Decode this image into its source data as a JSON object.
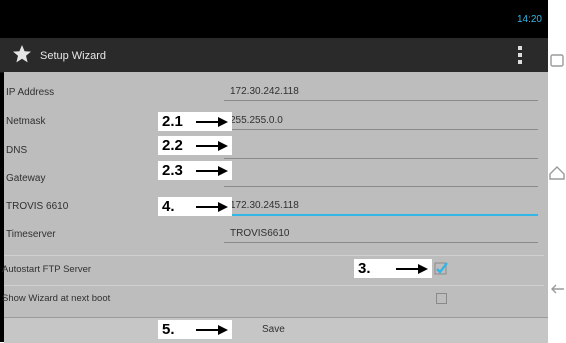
{
  "status_bar": {
    "time": "14:20"
  },
  "action_bar": {
    "title": "Setup Wizard",
    "app_icon": "star-icon",
    "menu_icon": "overflow-menu-icon"
  },
  "form": {
    "ip_address": {
      "label": "IP Address",
      "value": "172.30.242.118"
    },
    "netmask": {
      "label": "Netmask",
      "value": "255.255.0.0"
    },
    "dns": {
      "label": "DNS",
      "value": ""
    },
    "gateway": {
      "label": "Gateway",
      "value": ""
    },
    "trovis": {
      "label": "TROVIS 6610",
      "value": "172.30.245.118"
    },
    "timeserver": {
      "label": "Timeserver",
      "value": "TROVIS6610"
    },
    "autostart_ftp": {
      "label": "Autostart FTP Server",
      "checked": true
    },
    "show_wizard": {
      "label": "Show Wizard at next boot",
      "checked": false
    },
    "save_label": "Save"
  },
  "callouts": {
    "c21": "2.1",
    "c22": "2.2",
    "c23": "2.3",
    "c4": "4.",
    "c3": "3.",
    "c5": "5."
  },
  "colors": {
    "accent": "#33b5e5",
    "background": "#bdbdbd",
    "action_bar": "#2a2a2a"
  }
}
